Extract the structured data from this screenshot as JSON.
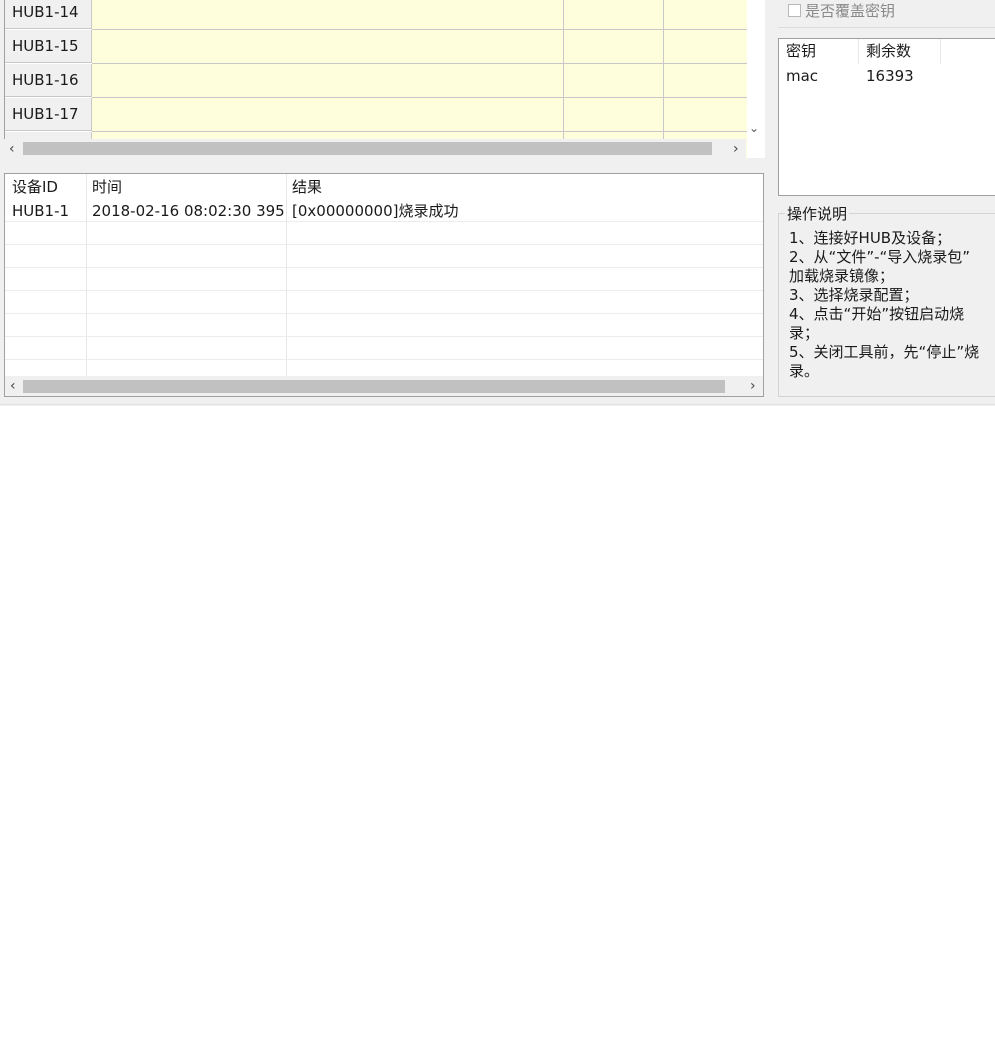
{
  "device_grid": {
    "rows": [
      {
        "id": "HUB1-14"
      },
      {
        "id": "HUB1-15"
      },
      {
        "id": "HUB1-16"
      },
      {
        "id": "HUB1-17"
      }
    ]
  },
  "log": {
    "columns": [
      "设备ID",
      "时间",
      "结果"
    ],
    "rows": [
      {
        "device": "HUB1-1",
        "time": "2018-02-16 08:02:30 395",
        "result": "[0x00000000]烧录成功"
      }
    ]
  },
  "options": {
    "overwrite_key_label": "是否覆盖密钥",
    "overwrite_key_checked": false
  },
  "keys": {
    "columns": [
      "密钥",
      "剩余数"
    ],
    "rows": [
      {
        "name": "mac",
        "remaining": "16393"
      }
    ]
  },
  "instructions": {
    "title": "操作说明",
    "steps": [
      [
        "1、连接好HUB及设备；"
      ],
      [
        "2、从“文件”-“导入烧录包”",
        "加载烧录镜像；"
      ],
      [
        "3、选择烧录配置；"
      ],
      [
        "4、点击“开始”按钮启动烧",
        "录；"
      ],
      [
        "5、关闭工具前，先“停止”烧",
        "录。"
      ]
    ]
  },
  "icons": {
    "scroll_left": "chevron-left-icon",
    "scroll_right": "chevron-right-icon",
    "scroll_down": "chevron-down-icon"
  }
}
